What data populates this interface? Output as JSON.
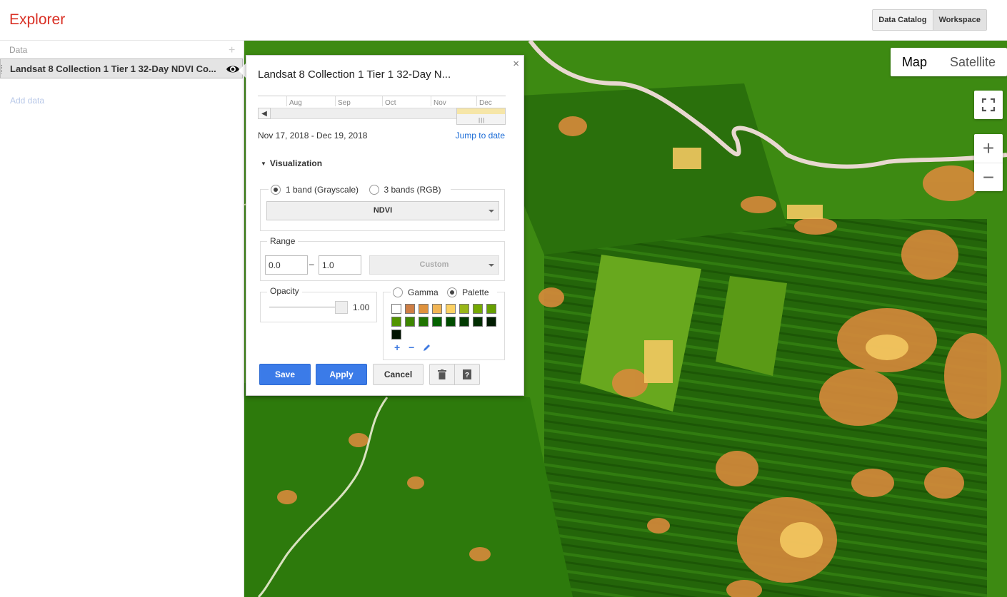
{
  "header": {
    "title": "Explorer",
    "nav": [
      "Data Catalog",
      "Workspace"
    ]
  },
  "sidebar": {
    "heading": "Data",
    "add_icon": "plus-icon",
    "layer": {
      "name": "Landsat 8 Collection 1 Tier 1 32-Day NDVI Co...",
      "visibility_icon": "eye-icon"
    },
    "add_data": "Add data"
  },
  "map": {
    "types": [
      "Map",
      "Satellite"
    ],
    "active_type": "Map",
    "controls": {
      "fullscreen": "fullscreen-icon",
      "zoom_in": "+",
      "zoom_out": "−"
    }
  },
  "popup": {
    "title": "Landsat 8 Collection 1 Tier 1 32-Day N...",
    "close": "×",
    "timeline": {
      "months": [
        "Aug",
        "Sep",
        "Oct",
        "Nov",
        "Dec"
      ]
    },
    "date_range": "Nov 17, 2018 - Dec 19, 2018",
    "jump_to_date": "Jump to date",
    "visualization": {
      "label": "Visualization",
      "band_modes": [
        "1 band (Grayscale)",
        "3 bands (RGB)"
      ],
      "selected_band_mode": "1 band (Grayscale)",
      "band": "NDVI",
      "range": {
        "label": "Range",
        "min": "0.0",
        "dash": "–",
        "max": "1.0",
        "preset": "Custom"
      },
      "opacity": {
        "label": "Opacity",
        "value": "1.00"
      },
      "color_modes": [
        "Gamma",
        "Palette"
      ],
      "selected_color_mode": "Palette",
      "palette": [
        "#ffffff",
        "#ce7e45",
        "#df923d",
        "#f1b555",
        "#fcd163",
        "#99b718",
        "#74a901",
        "#66a000",
        "#529400",
        "#3e8601",
        "#207401",
        "#056201",
        "#004c00",
        "#023b01",
        "#012e01",
        "#011d01",
        "#011301"
      ],
      "palette_tools": [
        "+",
        "−",
        "pencil-icon"
      ]
    },
    "buttons": {
      "save": "Save",
      "apply": "Apply",
      "cancel": "Cancel",
      "delete_icon": "trash-icon",
      "help_icon": "help-icon"
    }
  }
}
